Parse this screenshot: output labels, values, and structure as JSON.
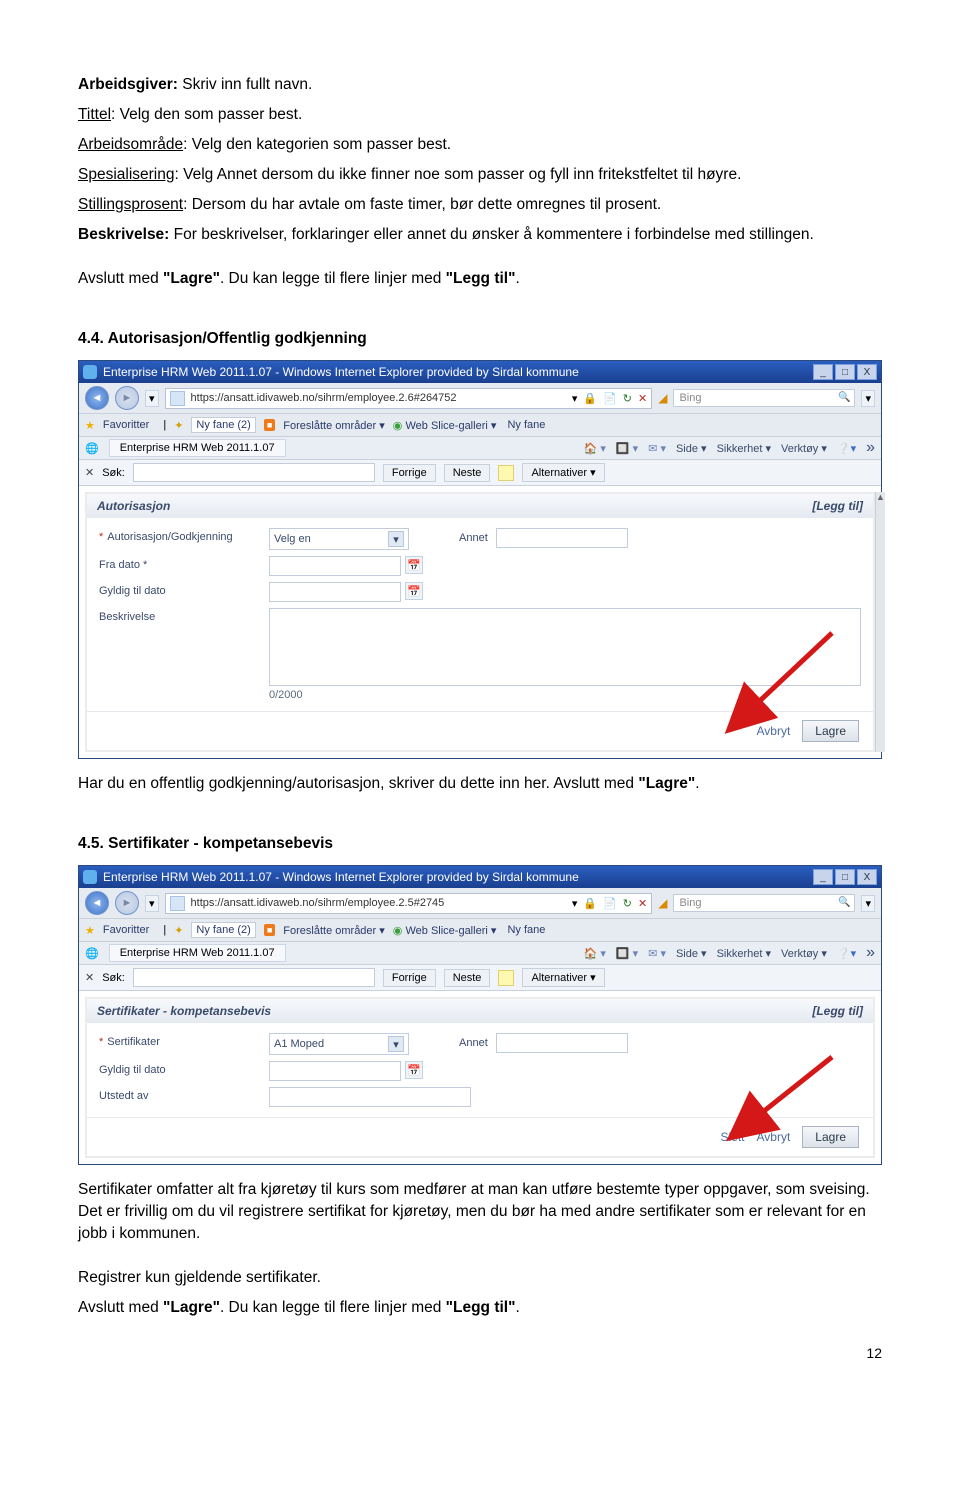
{
  "doc": {
    "p1_label": "Arbeidsgiver:",
    "p1_text": " Skriv inn fullt navn.",
    "p2_label": "Tittel",
    "p2_text": ": Velg den som passer best.",
    "p3_label": "Arbeidsområde",
    "p3_text": ": Velg den kategorien som passer best.",
    "p4_label": "Spesialisering",
    "p4_text": ": Velg Annet dersom du ikke finner noe som passer og fyll inn fritekstfeltet til høyre.",
    "p5_label": "Stillingsprosent",
    "p5_text": ": Dersom du har avtale om faste timer, bør dette omregnes til prosent.",
    "p6_label": "Beskrivelse:",
    "p6_text": " For beskrivelser, forklaringer eller annet du ønsker å kommentere i forbindelse med stillingen.",
    "p7a": "Avslutt med ",
    "p7a_q": "\"Lagre\"",
    "p7b": ". Du kan legge til flere linjer med ",
    "p7b_q": "\"Legg til\"",
    "p7c": ".",
    "h44": "4.4. Autorisasjon/Offentlig godkjenning",
    "mid1a": "Har du en offentlig godkjenning/autorisasjon, skriver du dette inn her.  Avslutt med ",
    "mid1b": "\"Lagre\"",
    "mid1c": ".",
    "h45": "4.5. Sertifikater - kompetansebevis",
    "end1": "Sertifikater omfatter alt fra kjøretøy til kurs som medfører at man kan utføre bestemte typer oppgaver, som sveising.  Det er frivillig om du vil registrere sertifikat for kjøretøy, men du bør ha med andre sertifikater som er relevant for en jobb i kommunen.",
    "end2": "Registrer kun gjeldende sertifikater.",
    "pgnum": "12"
  },
  "browser": {
    "title": "Enterprise HRM Web 2011.1.07 - Windows Internet Explorer provided by Sirdal kommune",
    "url1": "https://ansatt.idivaweb.no/sihrm/employee.2.6#264752",
    "url2": "https://ansatt.idivaweb.no/sihrm/employee.2.5#2745",
    "bing": "Bing",
    "fav": "Favoritter",
    "nyfane2": "Ny fane (2)",
    "foreslatte": "Foreslåtte områder  ▾",
    "webslice": "Web Slice-galleri  ▾",
    "nyfane": "Ny fane",
    "tab": "Enterprise HRM Web 2011.1.07",
    "side": "Side  ▾",
    "sikkerhet": "Sikkerhet  ▾",
    "verktoy": "Verktøy  ▾",
    "sok": "Søk:",
    "forrige": "Forrige",
    "neste": "Neste",
    "alt": "Alternativer  ▾"
  },
  "form1": {
    "header": "Autorisasjon",
    "leggtil": "[Legg til]",
    "l1": "Autorisasjon/Godkjenning",
    "sel1": "Velg en",
    "annet": "Annet",
    "l2": "Fra dato *",
    "l3": "Gyldig til dato",
    "l4": "Beskrivelse",
    "counter": "0/2000",
    "avbryt": "Avbryt",
    "lagre": "Lagre"
  },
  "form2": {
    "header": "Sertifikater - kompetansebevis",
    "leggtil": "[Legg til]",
    "l1": "Sertifikater",
    "sel1": "A1 Moped",
    "annet": "Annet",
    "l2": "Gyldig til dato",
    "l3": "Utstedt av",
    "slett": "Slett",
    "avbryt": "Avbryt",
    "lagre": "Lagre"
  }
}
